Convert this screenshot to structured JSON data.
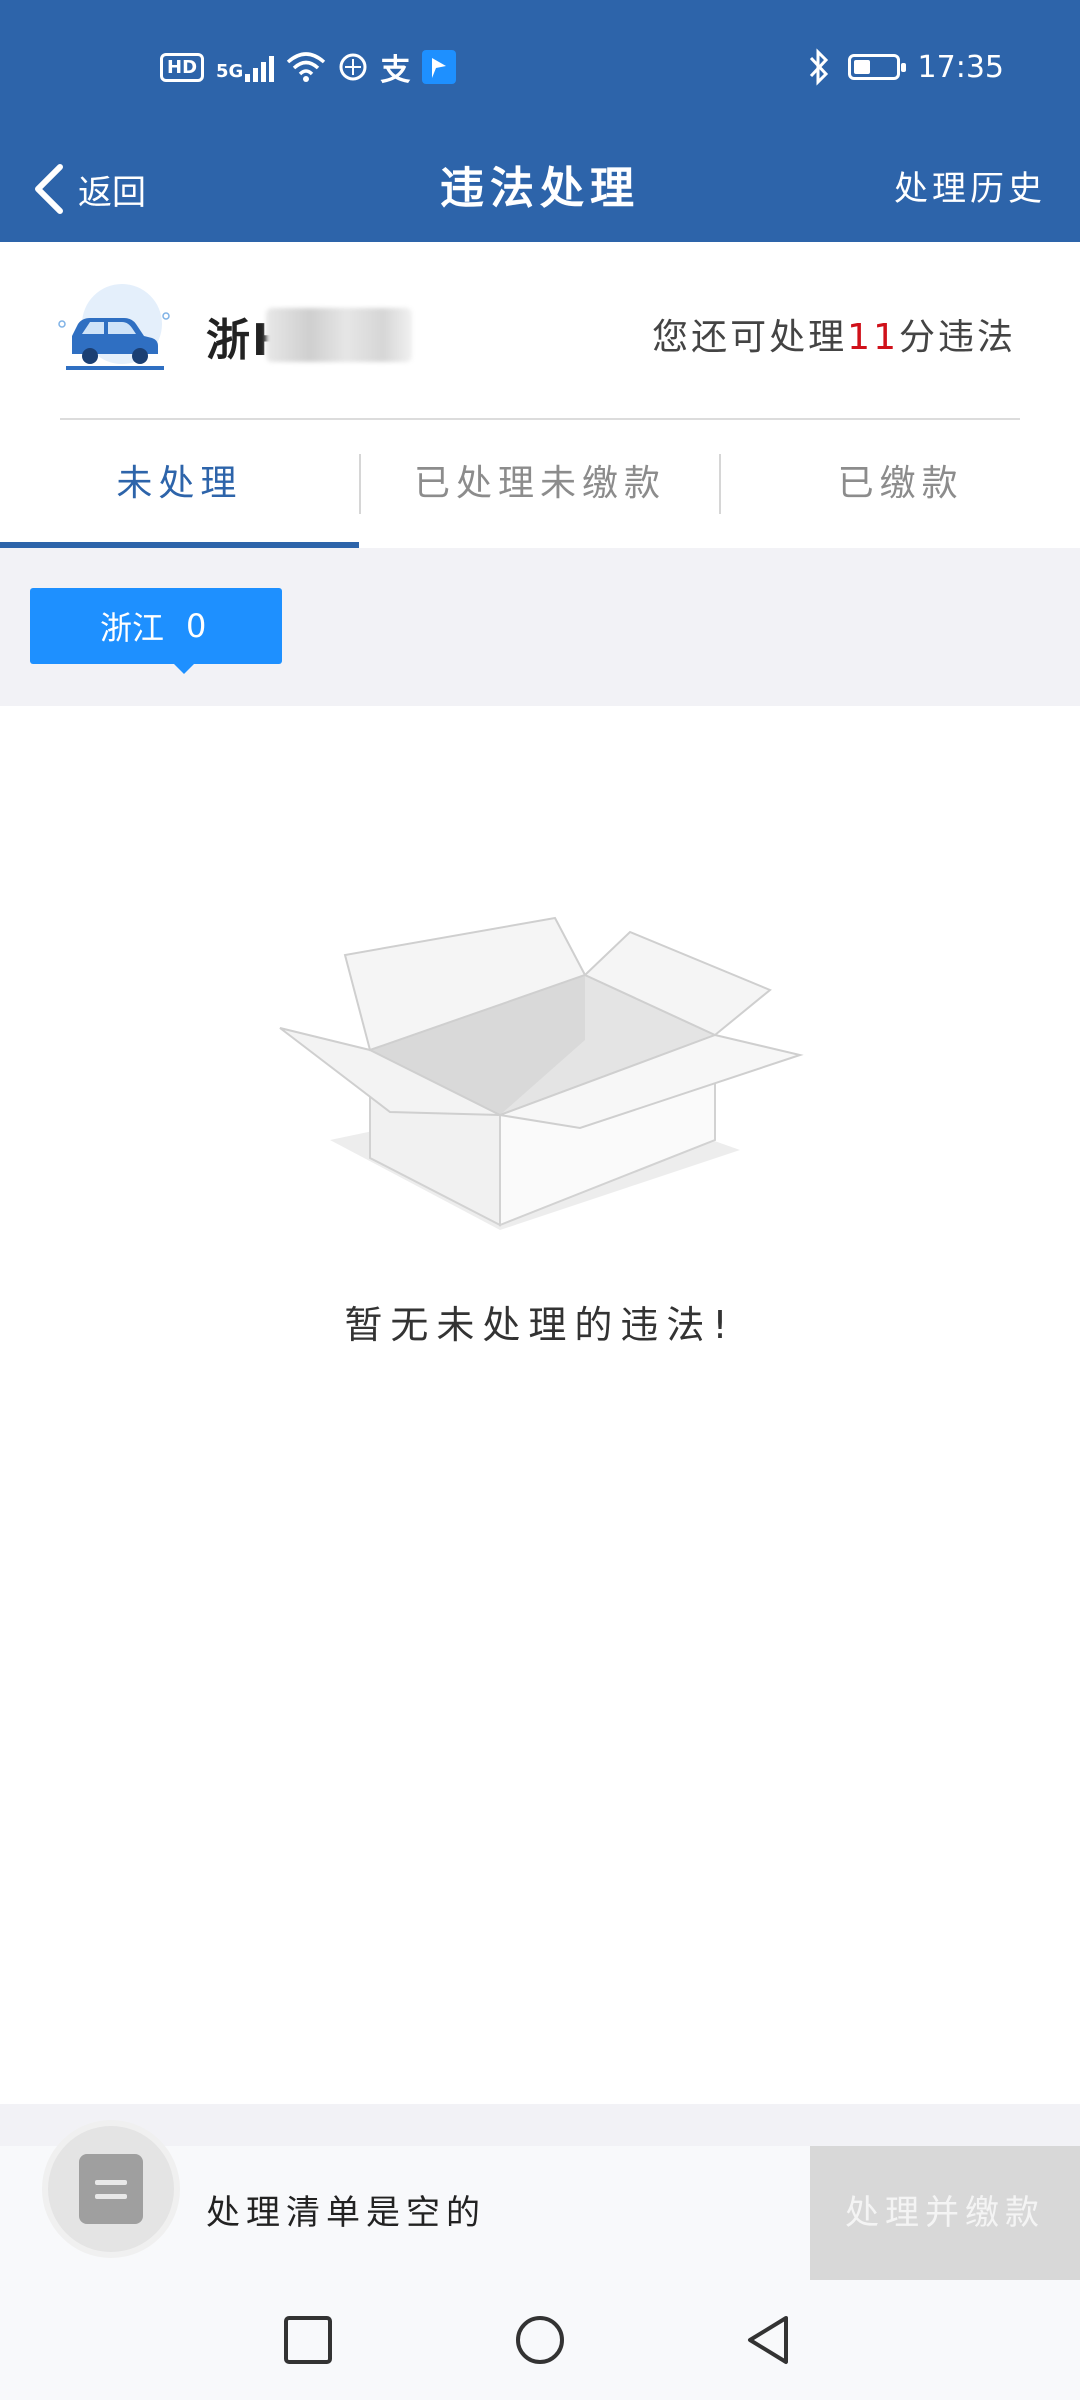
{
  "status_bar": {
    "hd_label": "HD",
    "network": "5G",
    "alipay_glyph": "支",
    "time": "17:35",
    "battery_percent": 40,
    "icons": [
      "hd-icon",
      "signal-5g-icon",
      "wifi-icon",
      "data-saver-icon",
      "alipay-icon",
      "app-notification-icon",
      "bluetooth-icon",
      "battery-icon"
    ]
  },
  "nav": {
    "back_label": "返回",
    "title": "违法处理",
    "history_label": "处理历史"
  },
  "vehicle": {
    "plate_visible": "浙H",
    "quota_prefix": "您还可处理",
    "quota_points": "11",
    "quota_suffix": "分违法"
  },
  "tabs": [
    {
      "label": "未处理",
      "active": true
    },
    {
      "label": "已处理未缴款",
      "active": false
    },
    {
      "label": "已缴款",
      "active": false
    }
  ],
  "region": {
    "province": "浙江",
    "count": "0"
  },
  "empty_state": {
    "message": "暂无未处理的违法!"
  },
  "cart": {
    "text": "处理清单是空的",
    "pay_button": "处理并缴款"
  },
  "colors": {
    "primary": "#2d64aa",
    "accent": "#1e90ff",
    "highlight": "#d0111a"
  }
}
